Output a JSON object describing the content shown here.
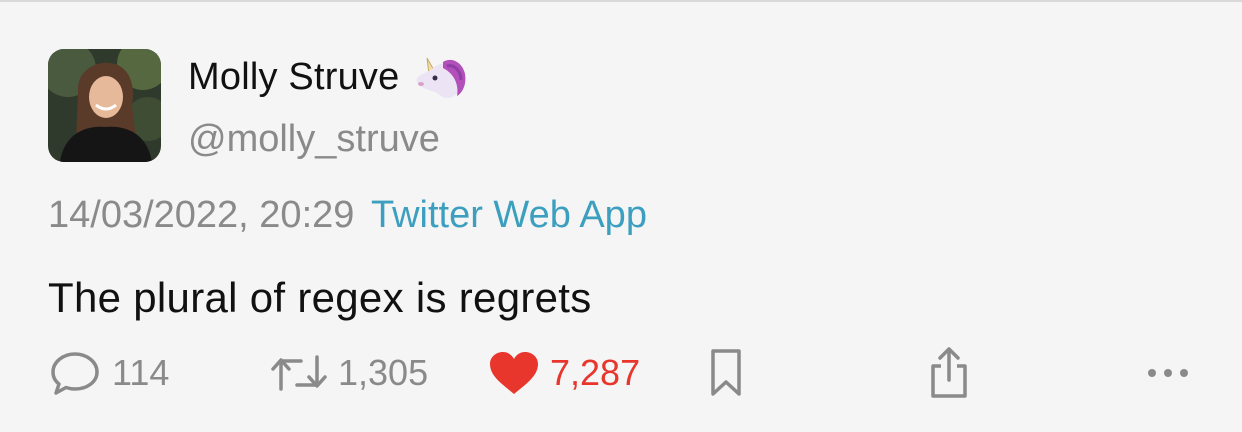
{
  "tweet": {
    "author_name": "Molly Struve",
    "handle": "@molly_struve",
    "date": "14/03/2022, 20:29",
    "source": "Twitter Web App",
    "text": "The plural of regex is regrets"
  },
  "actions": {
    "replies": "114",
    "retweets": "1,305",
    "likes": "7,287",
    "liked": true
  },
  "icons": {
    "reply": "speech-bubble-icon",
    "retweet": "retweet-arrows-icon",
    "like": "heart-icon",
    "bookmark": "bookmark-icon",
    "share": "share-icon",
    "more": "more-dots-icon",
    "badge": "unicorn-emoji-icon"
  },
  "colors": {
    "background": "#f5f5f5",
    "link": "#3d9fbf",
    "like": "#e8362c",
    "muted": "#8a8a8a"
  }
}
